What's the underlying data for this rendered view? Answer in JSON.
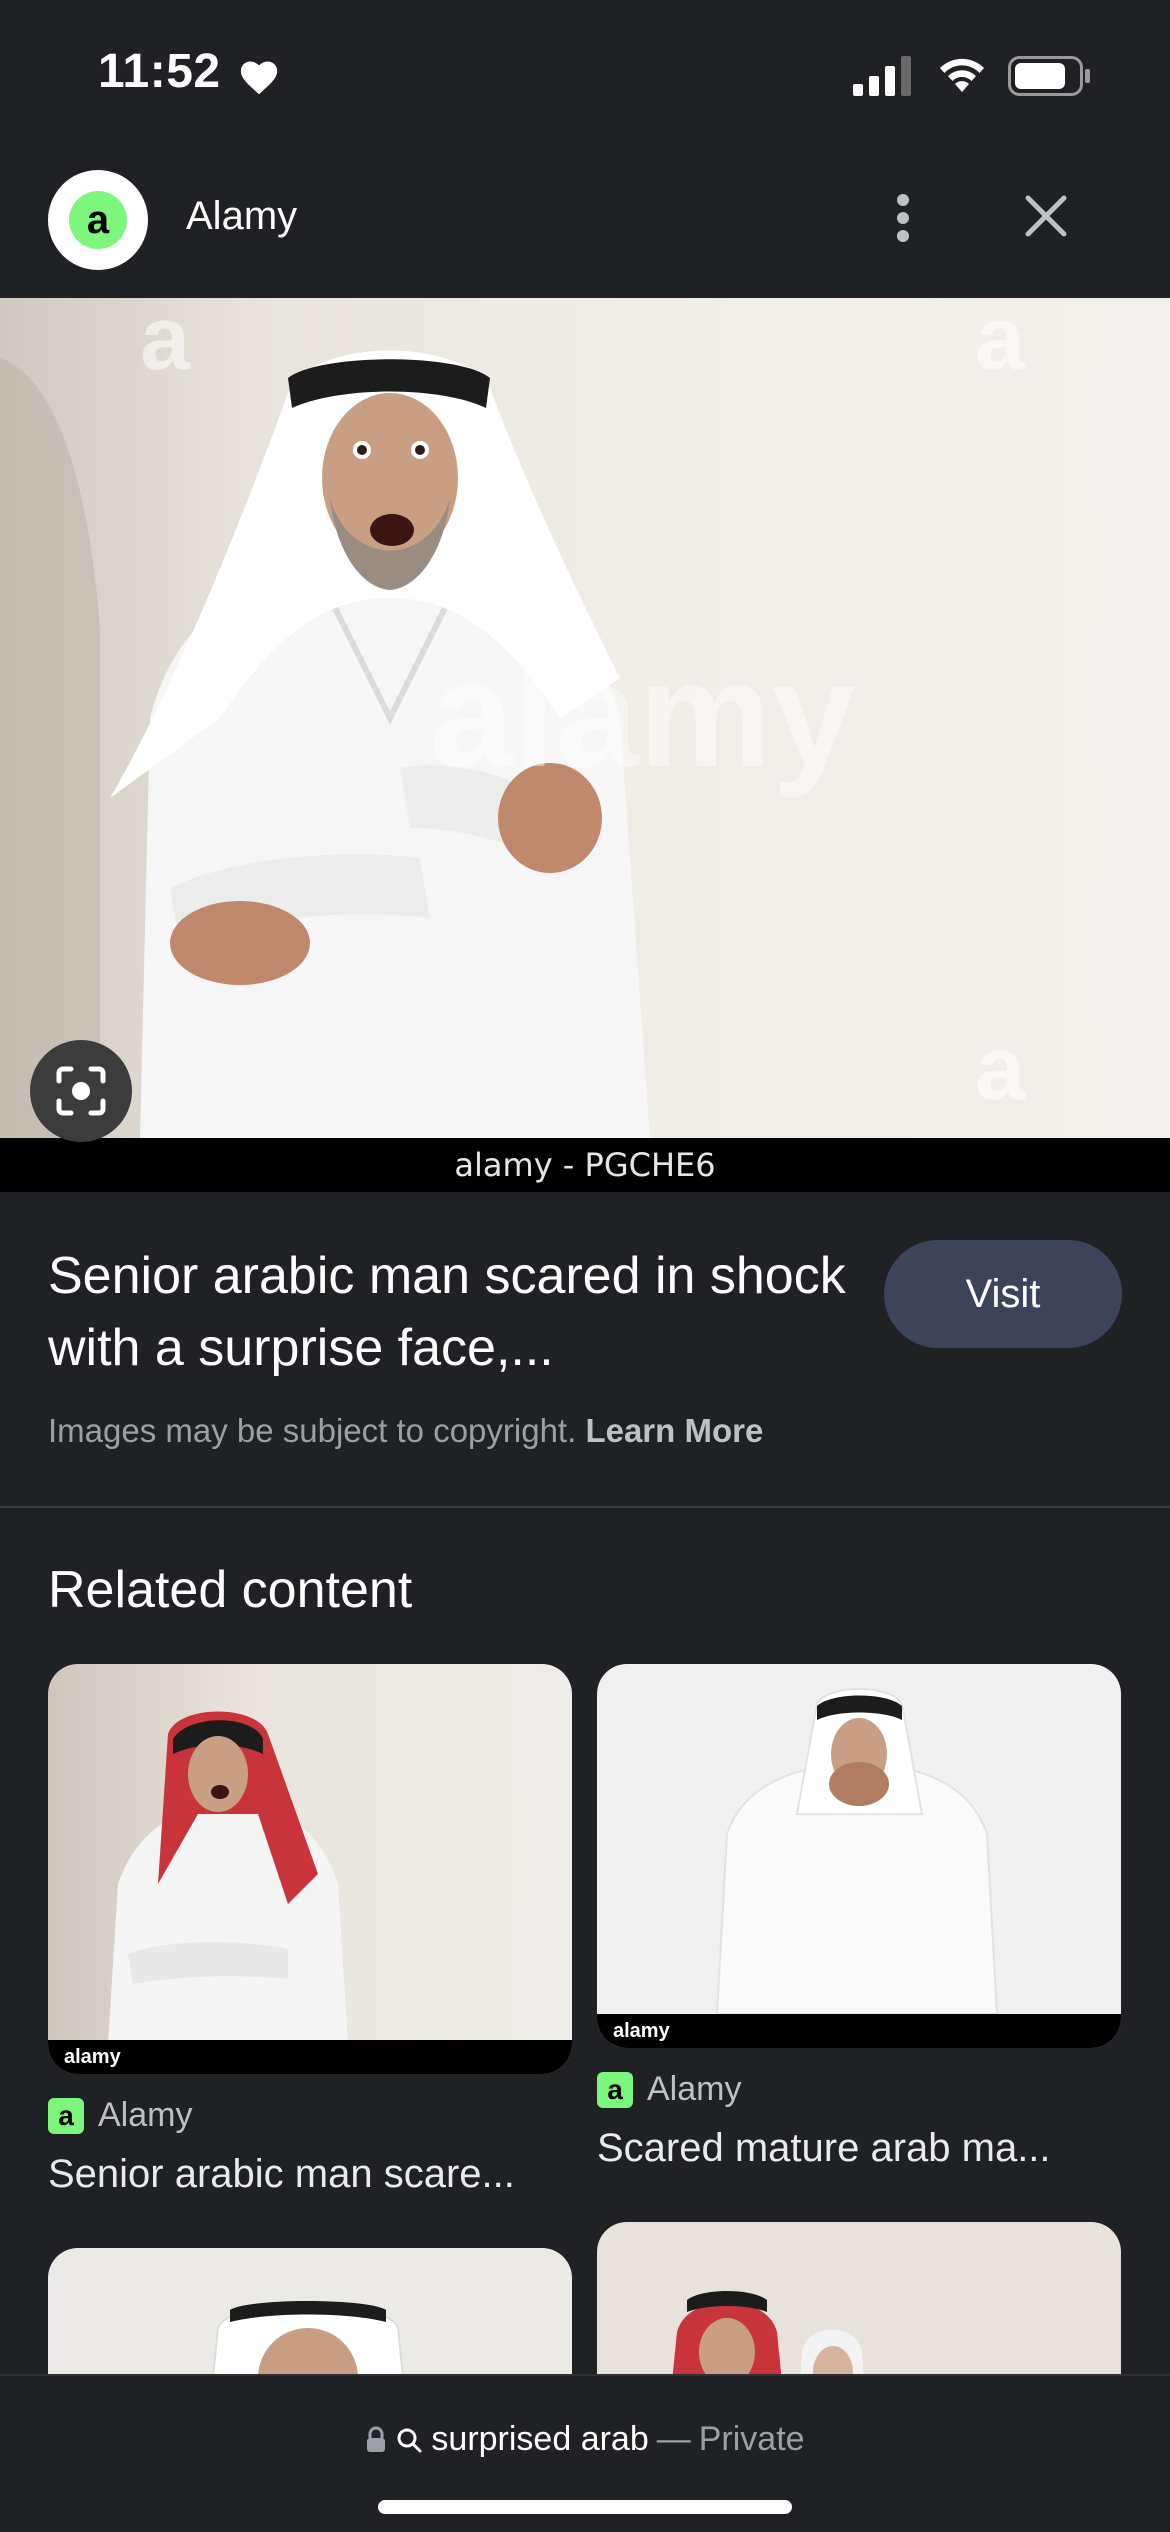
{
  "status_bar": {
    "time": "11:52"
  },
  "header": {
    "site_name": "Alamy",
    "logo_letter": "a"
  },
  "main_image": {
    "caption": "alamy - PGCHE6",
    "watermark_letter": "a",
    "watermark_word": "alamy"
  },
  "result": {
    "title": "Senior arabic man scared in shock with a surprise face,...",
    "visit_label": "Visit",
    "copyright_text": "Images may be subject to copyright.",
    "learn_more": "Learn More"
  },
  "related": {
    "heading": "Related content",
    "items": [
      {
        "source": "Alamy",
        "title": "Senior arabic man scare...",
        "strip": "alamy"
      },
      {
        "source": "Alamy",
        "title": "Scared mature arab ma...",
        "strip": "alamy"
      }
    ]
  },
  "bottom_bar": {
    "query": "surprised arab",
    "separator": "—",
    "mode": "Private"
  },
  "colors": {
    "accent_green": "#7cf77c",
    "visit_button": "#3c4459",
    "background": "#202124"
  }
}
